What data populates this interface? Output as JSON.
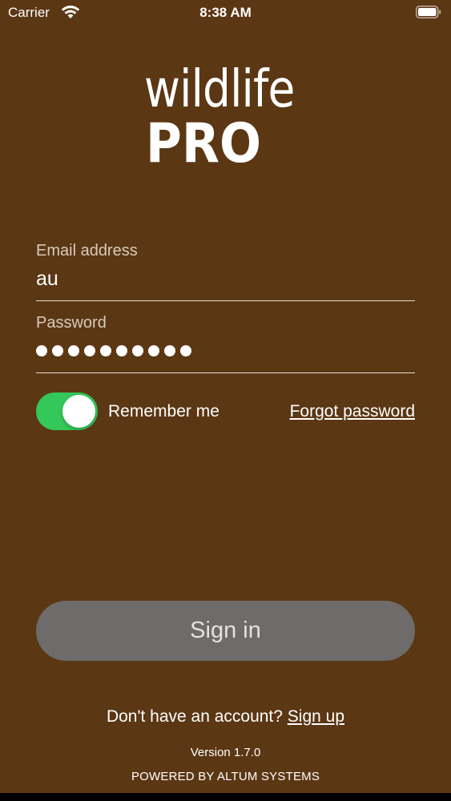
{
  "status_bar": {
    "carrier": "Carrier",
    "time": "8:38 AM",
    "wifi_icon": "wifi-icon",
    "battery_icon": "battery-icon"
  },
  "logo": {
    "line1": "wildlife",
    "line2": "PRO"
  },
  "form": {
    "email_label": "Email address",
    "email_value": "au",
    "password_label": "Password",
    "password_masked_length": 10,
    "remember_label": "Remember me",
    "remember_on": true,
    "forgot_label": "Forgot password",
    "sign_in_label": "Sign in"
  },
  "footer": {
    "signup_prompt": "Don't have an account?",
    "signup_link": "Sign up",
    "version": "Version 1.7.0",
    "powered_by": "POWERED BY ALTUM SYSTEMS"
  },
  "colors": {
    "background": "#5c3714",
    "toggle_on": "#34c759",
    "button": "#6e6c6b"
  }
}
